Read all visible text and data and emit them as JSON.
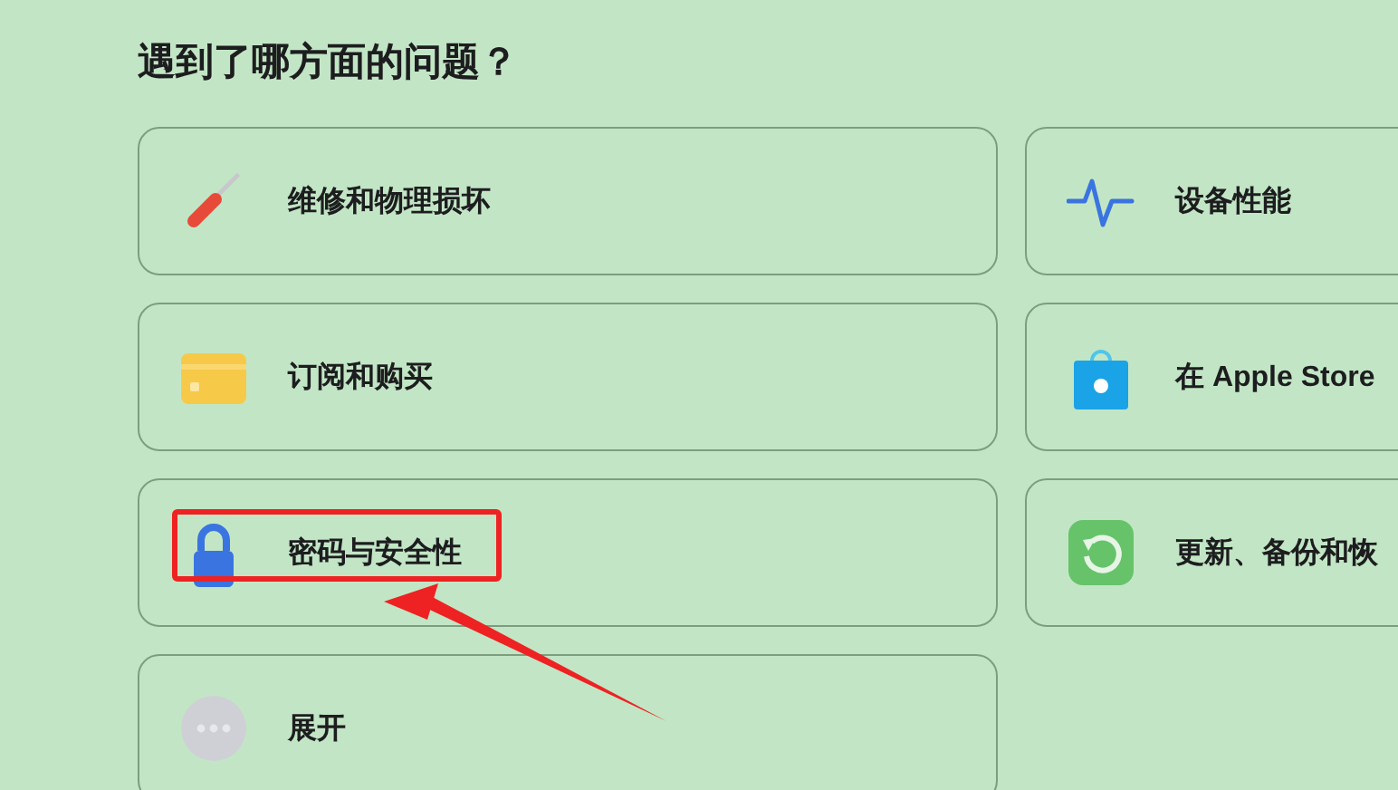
{
  "heading": "遇到了哪方面的问题？",
  "topics": [
    {
      "label": "维修和物理损坏",
      "kind": "screwdriver",
      "highlighted": false
    },
    {
      "label": "设备性能",
      "kind": "pulse",
      "highlighted": false
    },
    {
      "label": "订阅和购买",
      "kind": "card",
      "highlighted": false
    },
    {
      "label": "在 Apple Store",
      "kind": "bag",
      "highlighted": false
    },
    {
      "label": "密码与安全性",
      "kind": "lock",
      "highlighted": true
    },
    {
      "label": "更新、备份和恢",
      "kind": "restore",
      "highlighted": false
    },
    {
      "label": "展开",
      "kind": "more",
      "highlighted": false
    }
  ]
}
